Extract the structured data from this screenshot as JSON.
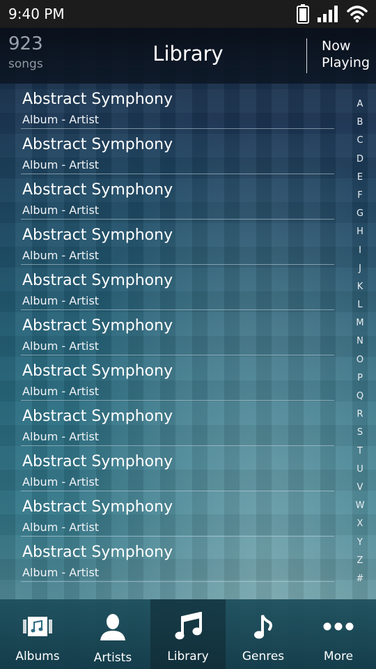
{
  "status_bar": {
    "time": "9:40 PM",
    "icons": [
      "battery-icon",
      "signal-icon",
      "wifi-icon"
    ]
  },
  "header": {
    "count": "923",
    "count_unit": "songs",
    "title": "Library",
    "now_playing": [
      "Now",
      "Playing"
    ]
  },
  "songs": [
    {
      "title": "Abstract Symphony",
      "subtitle": "Album - Artist"
    },
    {
      "title": "Abstract Symphony",
      "subtitle": "Album - Artist"
    },
    {
      "title": "Abstract Symphony",
      "subtitle": "Album - Artist"
    },
    {
      "title": "Abstract Symphony",
      "subtitle": "Album - Artist"
    },
    {
      "title": "Abstract Symphony",
      "subtitle": "Album - Artist"
    },
    {
      "title": "Abstract Symphony",
      "subtitle": "Album - Artist"
    },
    {
      "title": "Abstract Symphony",
      "subtitle": "Album - Artist"
    },
    {
      "title": "Abstract Symphony",
      "subtitle": "Album - Artist"
    },
    {
      "title": "Abstract Symphony",
      "subtitle": "Album - Artist"
    },
    {
      "title": "Abstract Symphony",
      "subtitle": "Album - Artist"
    },
    {
      "title": "Abstract Symphony",
      "subtitle": "Album - Artist"
    }
  ],
  "alphabet": [
    "A",
    "B",
    "C",
    "D",
    "E",
    "F",
    "G",
    "H",
    "I",
    "J",
    "K",
    "L",
    "M",
    "N",
    "O",
    "P",
    "Q",
    "R",
    "S",
    "T",
    "U",
    "V",
    "W",
    "X",
    "Y",
    "Z",
    "#"
  ],
  "tabs": [
    {
      "label": "Albums",
      "icon": "albums-icon",
      "active": false
    },
    {
      "label": "Artists",
      "icon": "artist-icon",
      "active": false
    },
    {
      "label": "Library",
      "icon": "music-notes-icon",
      "active": true
    },
    {
      "label": "Genres",
      "icon": "music-note-icon",
      "active": false
    },
    {
      "label": "More",
      "icon": "more-dots-icon",
      "active": false
    }
  ],
  "colors": {
    "status_bar_bg": "#1c1c1c",
    "text": "#ffffff",
    "count_text": "#9aa3ad"
  }
}
